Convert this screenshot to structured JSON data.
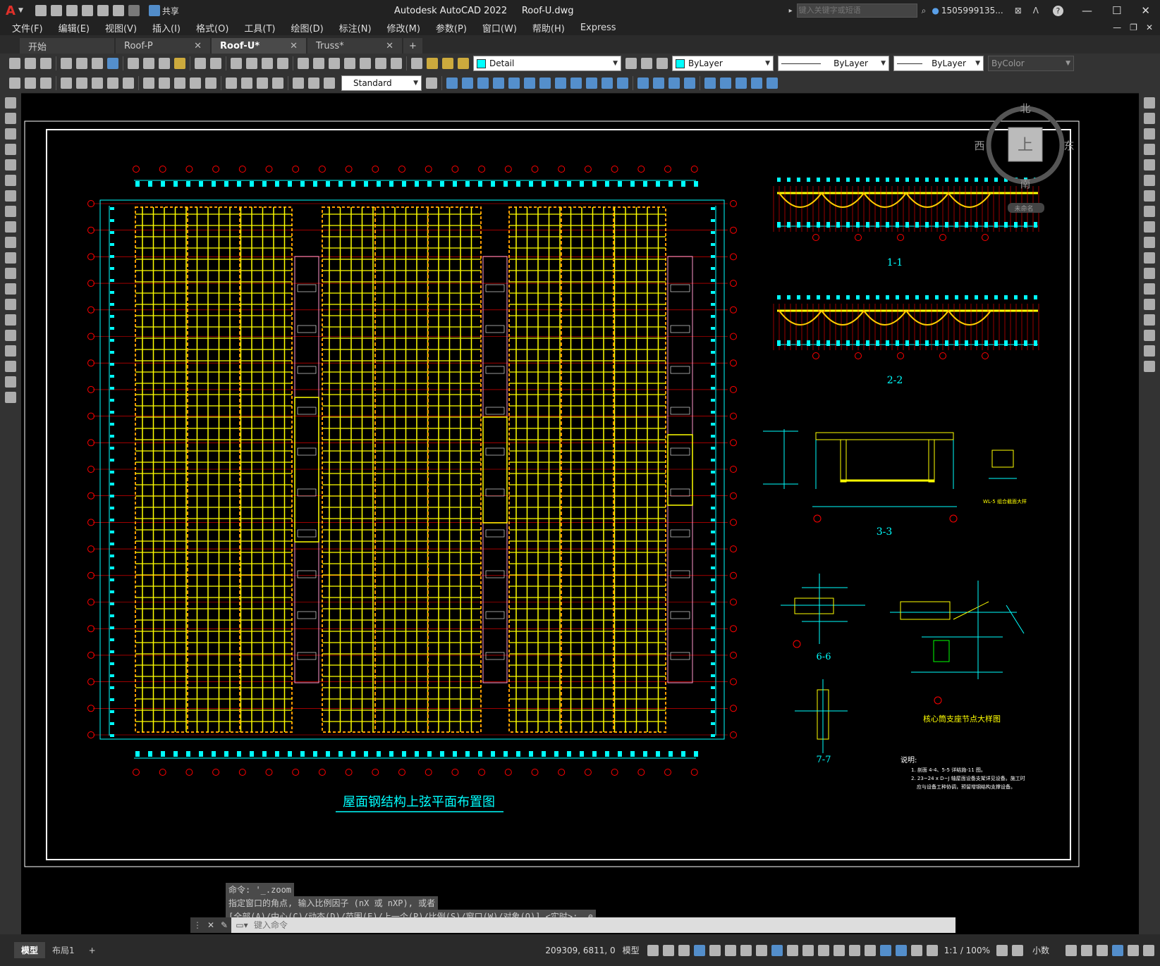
{
  "titlebar": {
    "app": "Autodesk AutoCAD 2022",
    "file": "Roof-U.dwg",
    "share": "共享",
    "search_placeholder": "键入关键字或短语",
    "user": "1505999135...",
    "help": "?"
  },
  "menu": [
    "文件(F)",
    "编辑(E)",
    "视图(V)",
    "插入(I)",
    "格式(O)",
    "工具(T)",
    "绘图(D)",
    "标注(N)",
    "修改(M)",
    "参数(P)",
    "窗口(W)",
    "帮助(H)",
    "Express"
  ],
  "tabs": [
    {
      "label": "开始",
      "close": ""
    },
    {
      "label": "Roof-P",
      "close": "✕"
    },
    {
      "label": "Roof-U*",
      "close": "✕"
    },
    {
      "label": "Truss*",
      "close": "✕"
    }
  ],
  "toolbar": {
    "layer": "Detail",
    "color": "ByLayer",
    "linetype": "ByLayer",
    "lineweight": "ByLayer",
    "plotstyle": "ByColor",
    "textstyle": "Standard"
  },
  "viewcube": {
    "north": "北",
    "south": "南",
    "east": "东",
    "west": "西",
    "top": "上",
    "ucs": "未命名"
  },
  "drawing": {
    "main_title": "屋面钢结构上弦平面布置图",
    "sec_1": "1-1",
    "sec_2": "2-2",
    "sec_3": "3-3",
    "sec_6": "6-6",
    "sec_7": "7-7",
    "detail_node": "核心筒支座节点大样图",
    "detail_small": "WL-5 组合截面大样",
    "notes_title": "说明:",
    "note1": "1. 剖面 4-4、5-5 详结施-11 图。",
    "note2": "2. 23~24 x D~J 轴屋面设备支架详见设备。施工时",
    "note3": "应与设备工种协调，预留增钢结构支撑设备。"
  },
  "command": {
    "line1": "命令: '_.zoom",
    "line2": "指定窗口的角点, 输入比例因子 (nX 或 nXP), 或者",
    "line3": "[全部(A)/中心(C)/动态(D)/范围(E)/上一个(P)/比例(S)/窗口(W)/对象(O)] <实时>: _e",
    "placeholder": "键入命令"
  },
  "status": {
    "model_tab": "模型",
    "layout_tab": "布局1",
    "plus": "+",
    "coords": "209309, 6811, 0",
    "mode": "模型",
    "scale": "1:1 / 100%",
    "units": "小数"
  }
}
